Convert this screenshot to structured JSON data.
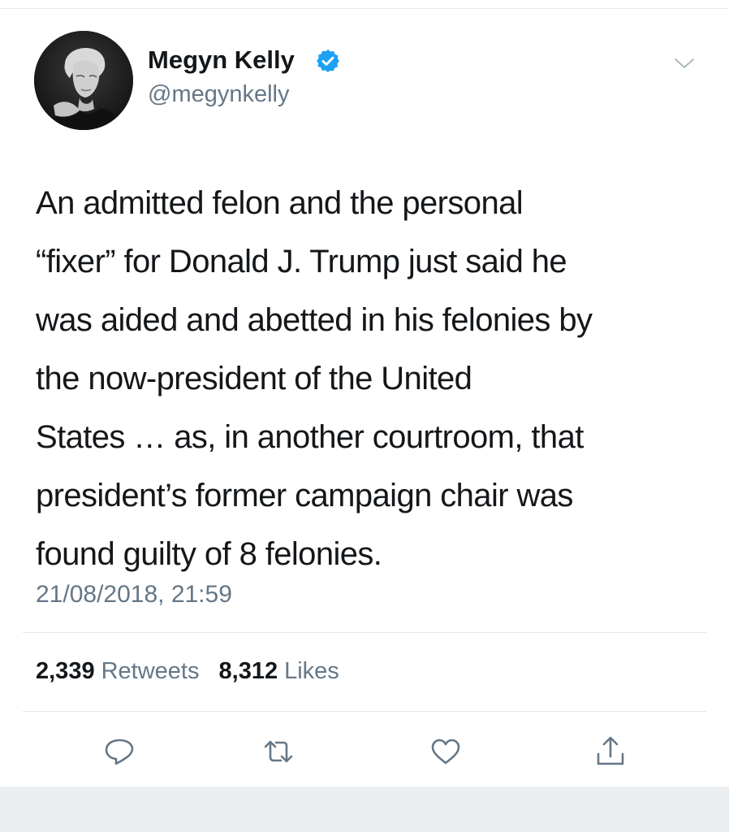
{
  "author": {
    "display_name": "Megyn Kelly",
    "handle": "@megynkelly",
    "verified_icon": "verified-badge-icon",
    "avatar": "profile-photo"
  },
  "menu": {
    "icon": "chevron-down-icon"
  },
  "tweet": {
    "lines": [
      "An admitted felon and the personal",
      "“fixer” for Donald J. Trump just said he",
      "was aided and abetted in his felonies by",
      "the now-president of the United",
      "States … as, in another courtroom, that",
      "president’s former campaign chair was",
      "found guilty of 8 felonies."
    ],
    "timestamp": "21/08/2018, 21:59"
  },
  "stats": {
    "retweets_count": "2,339",
    "retweets_label": "Retweets",
    "likes_count": "8,312",
    "likes_label": "Likes"
  },
  "actions": {
    "reply_icon": "reply-icon",
    "retweet_icon": "retweet-icon",
    "like_icon": "heart-icon",
    "share_icon": "share-icon"
  },
  "colors": {
    "text": "#14171a",
    "secondary_text": "#657786",
    "verified_blue": "#1da1f2",
    "icon_gray": "#657786",
    "divider": "#e1e8ed"
  }
}
